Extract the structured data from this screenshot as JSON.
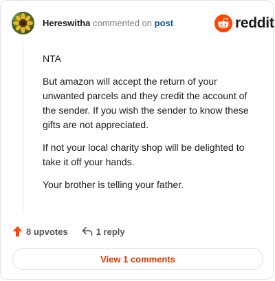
{
  "header": {
    "username": "Hereswitha",
    "commented_text": "commented on",
    "post_link": "post",
    "brand": "reddit",
    "avatar_icon": "sunflower-avatar",
    "brand_color": "#ff4500"
  },
  "comment": {
    "paragraphs": [
      "NTA",
      "But amazon will accept the return of your unwanted parcels and they credit the account of the sender. If you wish the sender to know these gifts are not appreciated.",
      "If not your local charity shop will be delighted to take it off your hands.",
      "Your brother is telling your father."
    ]
  },
  "actions": {
    "upvotes_label": "8 upvotes",
    "upvote_icon": "upvote-arrow-icon",
    "upvote_color": "#ff4500",
    "reply_label": "1 reply",
    "reply_icon": "reply-arrow-icon"
  },
  "footer": {
    "view_comments_label": "View 1 comments",
    "accent": "#d93a00"
  }
}
